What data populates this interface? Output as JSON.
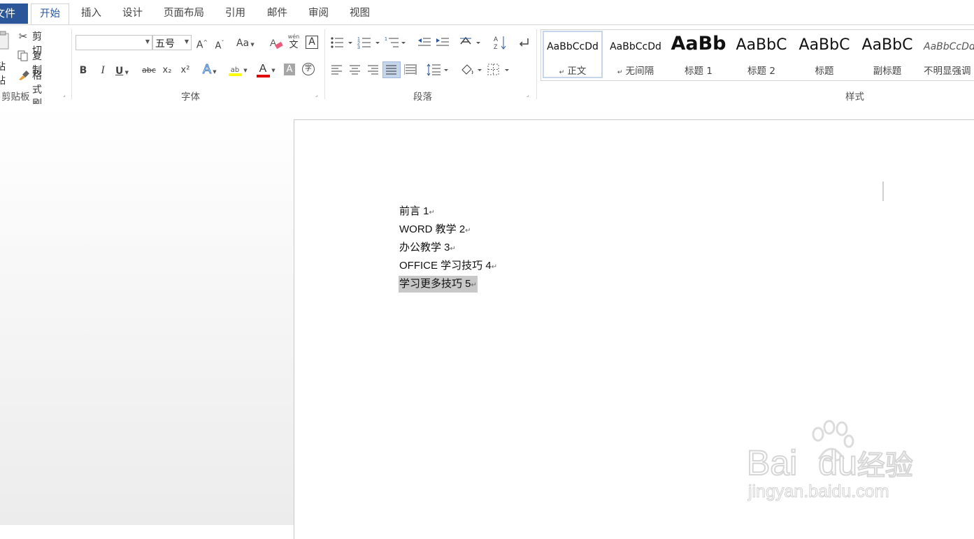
{
  "tabs": {
    "file": "文件",
    "home": "开始",
    "insert": "插入",
    "design": "设计",
    "layout": "页面布局",
    "references": "引用",
    "mailings": "邮件",
    "review": "审阅",
    "view": "视图"
  },
  "clipboard": {
    "paste": "粘贴",
    "cut": "剪切",
    "copy": "复制",
    "format_painter": "格式刷",
    "group_label": "剪贴板"
  },
  "font": {
    "font_name": "",
    "font_size": "五号",
    "change_case": "Aa",
    "phonetic_top": "wén",
    "phonetic_bottom": "文",
    "bold": "B",
    "italic": "I",
    "underline": "U",
    "strikethrough": "abc",
    "subscript": "x₂",
    "superscript": "x²",
    "text_effect": "A",
    "highlight": "ab",
    "font_color": "A",
    "char_shading": "A",
    "enclose": "字",
    "group_label": "字体",
    "highlight_color": "#ffff00",
    "font_color_value": "#ff0000"
  },
  "paragraph": {
    "group_label": "段落"
  },
  "styles": {
    "group_label": "样式",
    "items": [
      {
        "preview": "AaBbCcDd",
        "name": "正文",
        "mark": "↵"
      },
      {
        "preview": "AaBbCcDd",
        "name": "无间隔",
        "mark": "↵"
      },
      {
        "preview": "AaBb",
        "name": "标题 1",
        "mark": ""
      },
      {
        "preview": "AaBbC",
        "name": "标题 2",
        "mark": ""
      },
      {
        "preview": "AaBbC",
        "name": "标题",
        "mark": ""
      },
      {
        "preview": "AaBbC",
        "name": "副标题",
        "mark": ""
      },
      {
        "preview": "AaBbCcDd",
        "name": "不明显强调",
        "mark": ""
      }
    ]
  },
  "document": {
    "lines": [
      {
        "text": "前言 1"
      },
      {
        "text": "WORD 教学 2"
      },
      {
        "text": "办公教学 3"
      },
      {
        "text": "OFFICE 学习技巧 4"
      },
      {
        "text": "学习更多技巧 5"
      }
    ],
    "paragraph_mark": "↵"
  },
  "watermark": {
    "brand": "Bai",
    "brand_tail": "du",
    "cn": "经验",
    "url": "jingyan.baidu.com"
  },
  "colors": {
    "file_tab": "#2b579a",
    "active_tab_text": "#2b579a",
    "selection": "#c8c8c8"
  }
}
